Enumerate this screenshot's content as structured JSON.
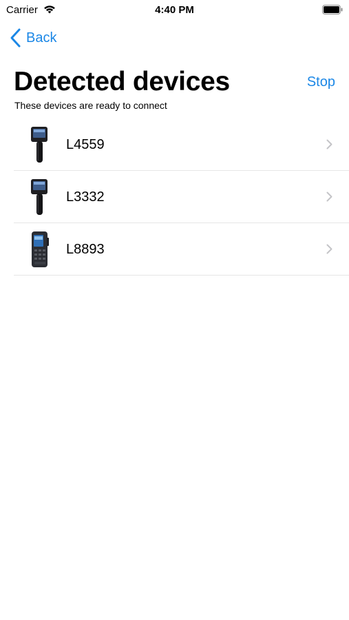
{
  "status_bar": {
    "carrier": "Carrier",
    "time": "4:40 PM",
    "wifi_icon": "wifi-icon",
    "battery_icon": "battery-icon"
  },
  "nav": {
    "back_label": "Back",
    "back_icon": "chevron-left-icon",
    "stop_label": "Stop"
  },
  "header": {
    "title": "Detected devices",
    "subtitle": "These devices are ready to connect"
  },
  "devices": [
    {
      "name": "L4559",
      "icon": "handheld-device-icon",
      "chevron": "chevron-right-icon"
    },
    {
      "name": "L3332",
      "icon": "handheld-device-icon",
      "chevron": "chevron-right-icon"
    },
    {
      "name": "L8893",
      "icon": "handheld-radio-icon",
      "chevron": "chevron-right-icon"
    }
  ],
  "colors": {
    "accent": "#1b87e6",
    "separator": "#e6e6e6",
    "chevron": "#c4c4c7"
  }
}
